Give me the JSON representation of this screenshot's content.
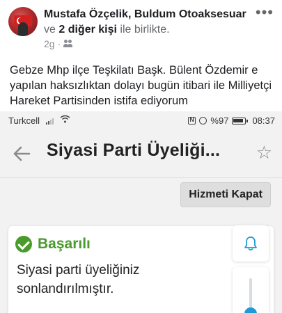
{
  "post": {
    "author": "Mustafa Özçelik",
    "separator": ",",
    "with_page": "Buldum Otoaksesuar",
    "line2_prefix": "ve",
    "others": "2 diğer kişi",
    "line2_suffix": "ile birlikte.",
    "time": "2g",
    "dot": "·",
    "audience_icon": "friends-icon",
    "more_icon": "•••",
    "text": "Gebze Mhp ilçe Teşkilatı Başk. Bülent Özdemir e yapılan haksızlıktan dolayı bugün itibari ile Milliyetçi Hareket Partisinden istifa ediyorum"
  },
  "phone": {
    "status": {
      "carrier": "Turkcell",
      "battery": "%97",
      "time": "08:37"
    },
    "appbar": {
      "title": "Siyasi Parti Üyeliği...",
      "back_icon": "back-arrow-icon",
      "star_icon": "star-outline-icon"
    },
    "close_button": "Hizmeti Kapat",
    "card": {
      "status_title": "Başarılı",
      "message": "Siyasi parti üyeliğiniz sonlandırılmıştır."
    },
    "colors": {
      "success": "#4a9a2c",
      "accent": "#1d9bd6"
    }
  }
}
